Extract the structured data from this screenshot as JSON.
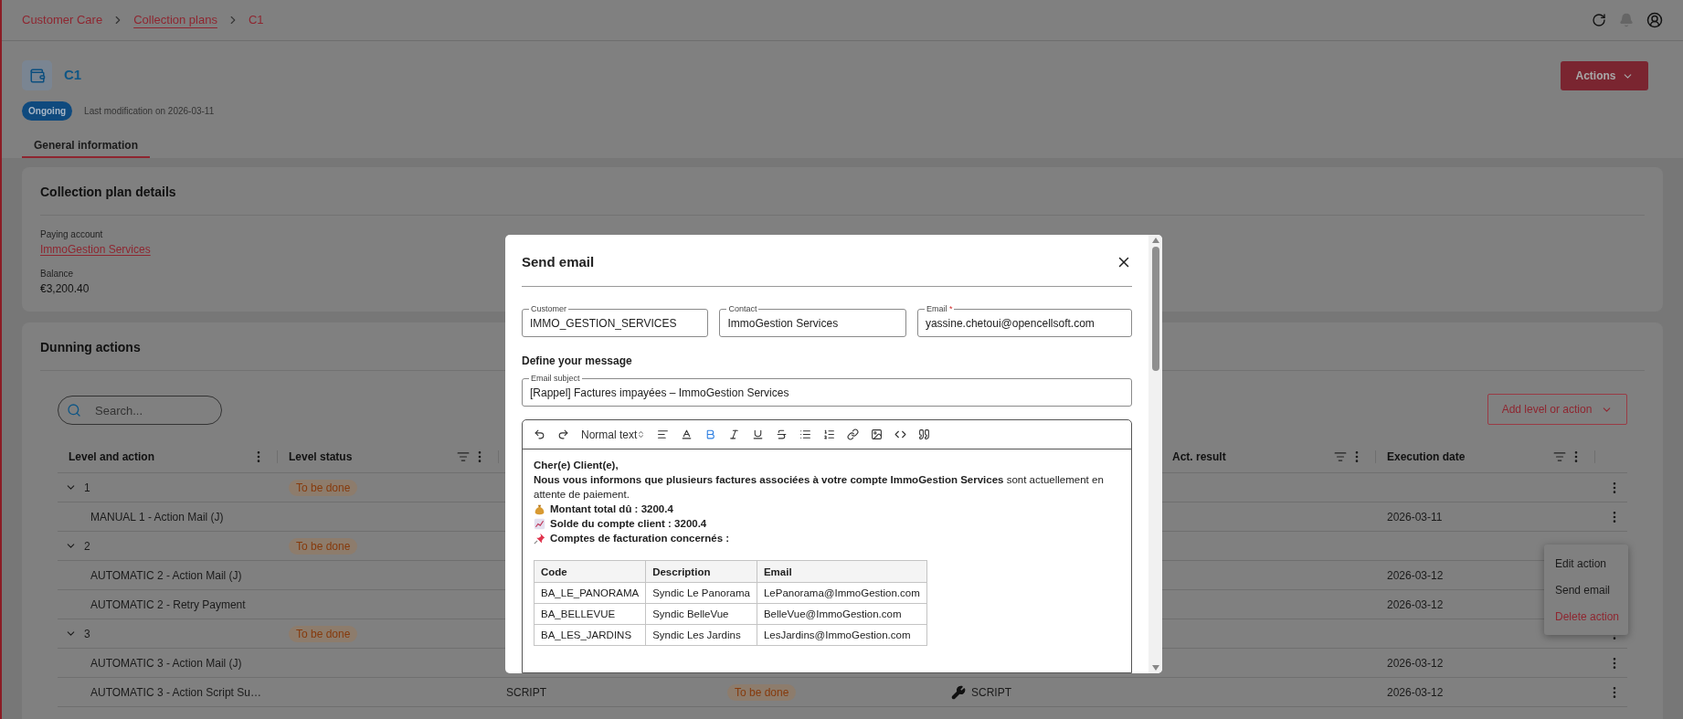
{
  "breadcrumbs": [
    {
      "label": "Customer Care",
      "underlined": false
    },
    {
      "label": "Collection plans",
      "underlined": true
    },
    {
      "label": "C1",
      "underlined": false
    }
  ],
  "header": {
    "title": "C1",
    "status": "Ongoing",
    "last_modified": "Last modification on 2026-03-11",
    "actions_button": "Actions"
  },
  "tabs": [
    {
      "label": "General information",
      "selected": true
    }
  ],
  "details": {
    "title": "Collection plan details",
    "fields": [
      {
        "label": "Paying account",
        "value": "ImmoGestion Services",
        "kind": "link"
      },
      {
        "label": "Balance",
        "value": "€3,200.40",
        "kind": "text"
      }
    ]
  },
  "dunning": {
    "title": "Dunning actions",
    "search_placeholder": "Search...",
    "add_button": "Add level or action",
    "columns": [
      {
        "label": "Level and action",
        "filter": false
      },
      {
        "label": "Level status",
        "filter": true
      },
      {
        "label": "Act. result",
        "filter": true
      },
      {
        "label": "Execution date",
        "filter": true
      }
    ],
    "rows": [
      {
        "level": "1",
        "expanded": true,
        "status": "To be done",
        "children": [
          {
            "name": "MANUAL 1 - Action Mail (J)",
            "execution_date": "2026-03-11",
            "menu_open": true
          }
        ]
      },
      {
        "level": "2",
        "expanded": true,
        "status": "To be done",
        "children": [
          {
            "name": "AUTOMATIC 2 - Action Mail (J)",
            "execution_date": "2026-03-12"
          },
          {
            "name": "AUTOMATIC 2 - Retry Payment",
            "execution_date": "2026-03-12"
          }
        ]
      },
      {
        "level": "3",
        "expanded": true,
        "status": "To be done",
        "children": [
          {
            "name": "AUTOMATIC 3 - Action Mail (J)",
            "execution_date": "2026-03-12"
          },
          {
            "name": "AUTOMATIC 3 - Action Script Su…",
            "type": "SCRIPT",
            "status": "To be done",
            "channel": "SCRIPT",
            "kind": "script",
            "execution_date": "2026-03-12"
          }
        ]
      }
    ]
  },
  "row_menu": [
    {
      "label": "Edit action",
      "kind": "normal"
    },
    {
      "label": "Send email",
      "kind": "normal"
    },
    {
      "label": "Delete action",
      "kind": "danger"
    }
  ],
  "modal": {
    "title": "Send email",
    "fields": [
      {
        "label": "Customer",
        "value": "IMMO_GESTION_SERVICES",
        "required": false
      },
      {
        "label": "Contact",
        "value": "ImmoGestion Services",
        "required": false
      },
      {
        "label": "Email",
        "value": "yassine.chetoui@opencellsoft.com",
        "required": true
      }
    ],
    "required_mark": "*",
    "section": "Define your message",
    "subject": {
      "label": "Email subject",
      "value": "[Rappel] Factures impayées – ImmoGestion Services"
    },
    "toolbar": {
      "format_label": "Normal text",
      "bold_active": true
    },
    "body": [
      {
        "text": "Cher(e) Client(e),",
        "bold": true,
        "kind": "plain"
      },
      {
        "text": "**Nous vous informons que plusieurs factures associées à votre compte ImmoGestion Services** sont actuellement en attente de paiement.",
        "bold": false,
        "kind": "plain"
      },
      {
        "text": "Montant total dû : 3200.4",
        "bold": true,
        "kind": "money"
      },
      {
        "text": "Solde du compte client : 3200.4",
        "bold": true,
        "kind": "chart"
      },
      {
        "text": "Comptes de facturation concernés :",
        "bold": true,
        "kind": "pin"
      }
    ],
    "table": {
      "columns": [
        "Code",
        "Description",
        "Email"
      ],
      "rows": [
        [
          "BA_LE_PANORAMA",
          "Syndic Le Panorama",
          "LePanorama@ImmoGestion.com"
        ],
        [
          "BA_BELLEVUE",
          "Syndic BelleVue",
          "BelleVue@ImmoGestion.com"
        ],
        [
          "BA_LES_JARDINS",
          "Syndic Les Jardins",
          "LesJardins@ImmoGestion.com"
        ]
      ]
    }
  }
}
